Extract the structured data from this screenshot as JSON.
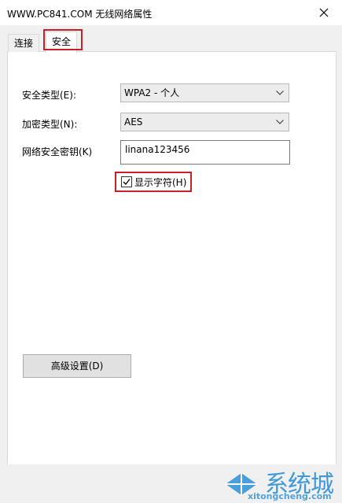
{
  "window": {
    "title": "WWW.PC841.COM 无线网络属性"
  },
  "tabs": [
    {
      "label": "连接"
    },
    {
      "label": "安全"
    }
  ],
  "form": {
    "security_type_label": "安全类型(E):",
    "security_type_value": "WPA2 - 个人",
    "encryption_type_label": "加密类型(N):",
    "encryption_type_value": "AES",
    "network_key_label": "网络安全密钥(K)",
    "network_key_value": "linana123456",
    "show_chars_label": "显示字符(H)",
    "show_chars_checked": true
  },
  "advanced_button_label": "高级设置(D)",
  "watermark": {
    "text": "系统城",
    "sub": "xitongcheng.com"
  },
  "colors": {
    "highlight": "#c91f2a",
    "watermark": "#2b8fd8"
  }
}
